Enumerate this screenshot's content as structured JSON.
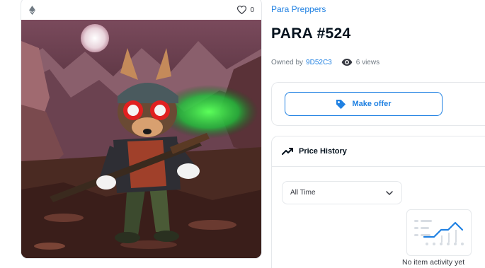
{
  "asset": {
    "favorites_count": "0",
    "collection_name": "Para Preppers",
    "title": "PARA #524",
    "owned_by_label": "Owned by",
    "owner": "9D52C3",
    "views": "6 views"
  },
  "actions": {
    "make_offer_label": "Make offer"
  },
  "price_history": {
    "title": "Price History",
    "time_filter": "All Time",
    "empty_message": "No item activity yet"
  },
  "icons": {
    "chain": "ethereum-icon",
    "favorite": "heart-icon",
    "views": "eye-icon",
    "offer": "tag-icon",
    "history": "trend-icon",
    "dropdown": "chevron-down-icon"
  },
  "colors": {
    "accent": "#2081e2",
    "text": "#04111d",
    "muted": "#707a83",
    "border": "#e5e8eb"
  }
}
